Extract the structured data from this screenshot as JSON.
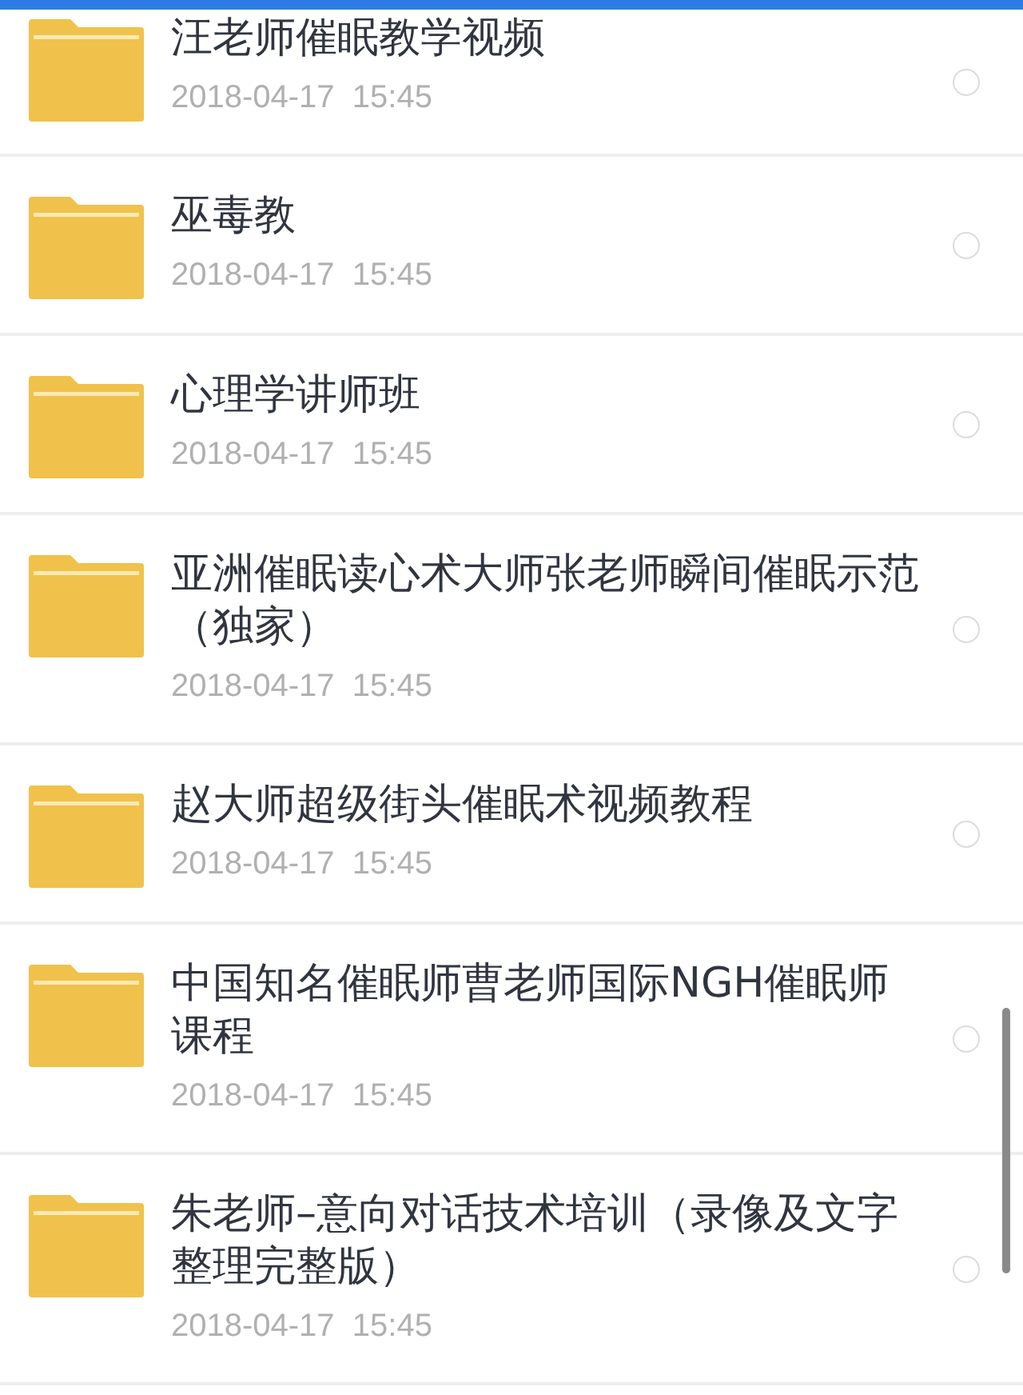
{
  "files": [
    {
      "name": "汪老师催眠教学视频",
      "date": "2018-04-17  15:45",
      "selected": false
    },
    {
      "name": "巫毒教",
      "date": "2018-04-17  15:45",
      "selected": false
    },
    {
      "name": "心理学讲师班",
      "date": "2018-04-17  15:45",
      "selected": false
    },
    {
      "name": "亚洲催眠读心术大师张老师瞬间催眠示范（独家）",
      "date": "2018-04-17  15:45",
      "selected": false
    },
    {
      "name": "赵大师超级街头催眠术视频教程",
      "date": "2018-04-17  15:45",
      "selected": false
    },
    {
      "name": "中国知名催眠师曹老师国际NGH催眠师课程",
      "date": "2018-04-17  15:45",
      "selected": false
    },
    {
      "name": "朱老师–意向对话技术培训（录像及文字整理完整版）",
      "date": "2018-04-17  15:45",
      "selected": false
    }
  ]
}
